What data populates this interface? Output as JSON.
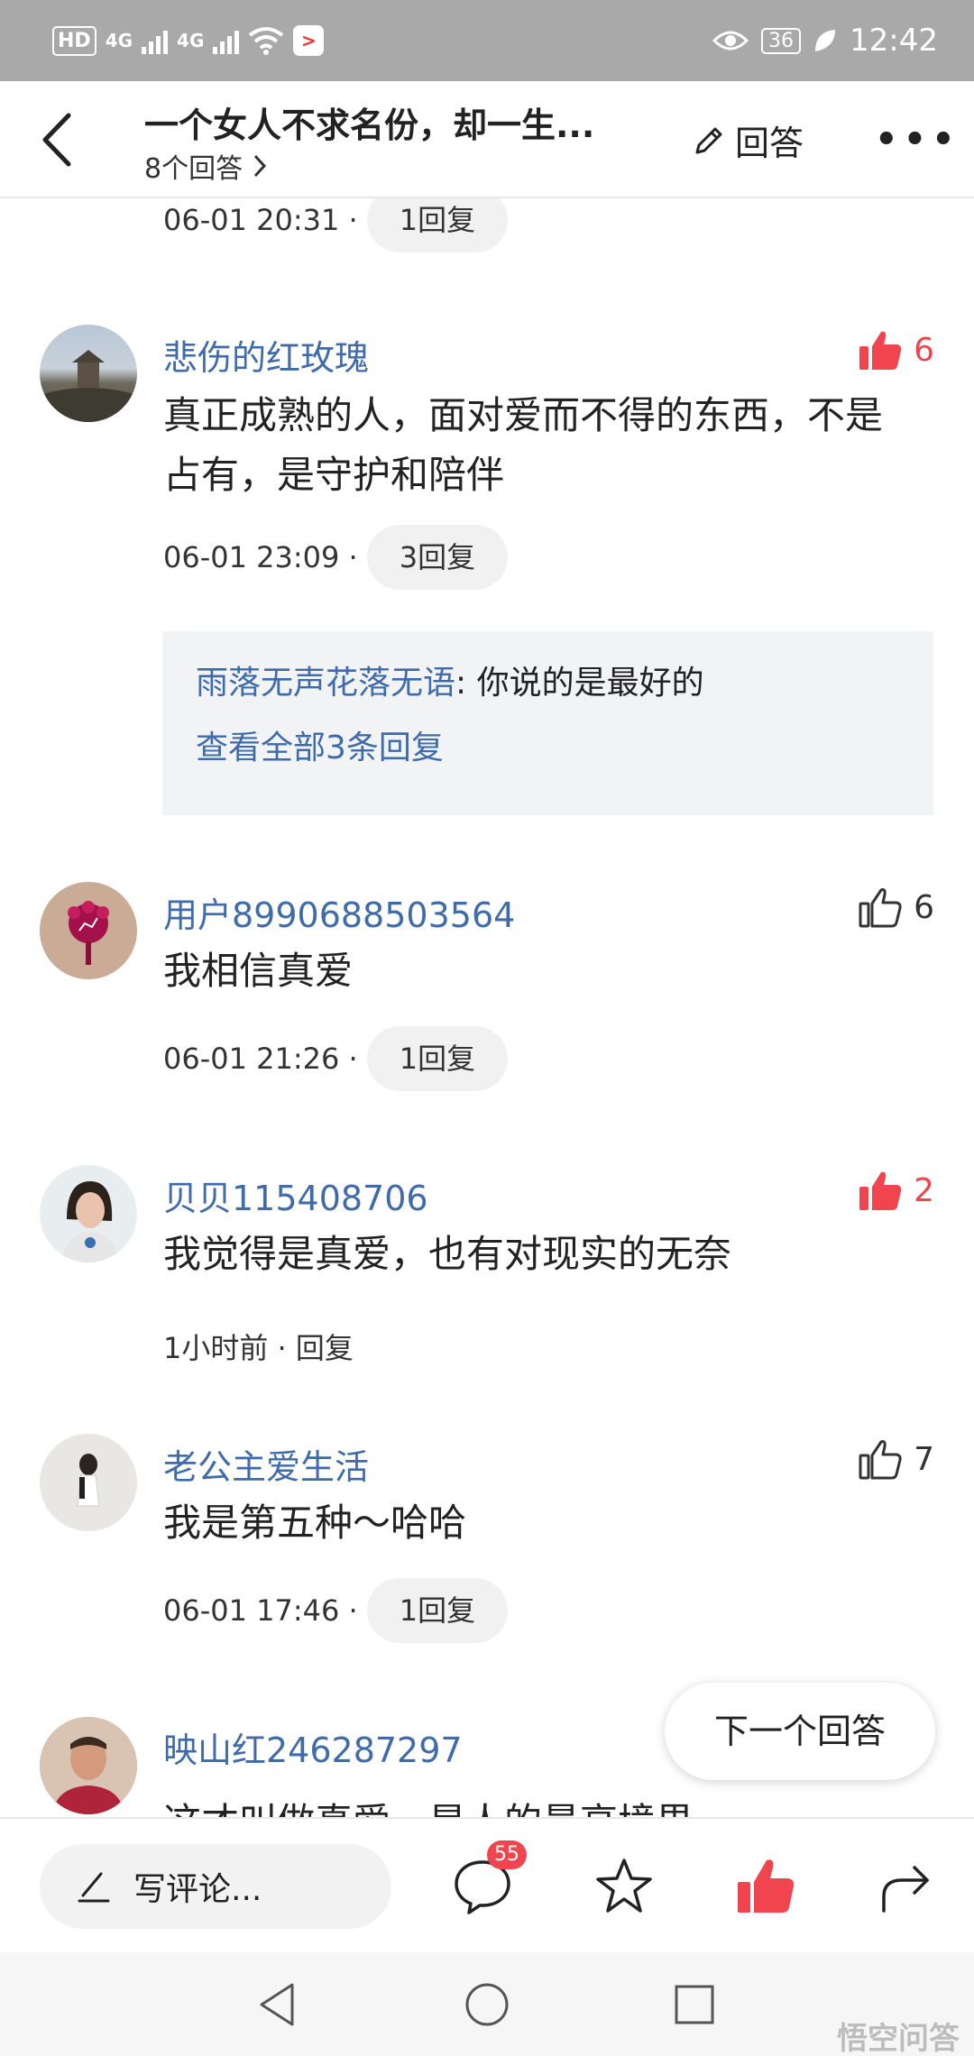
{
  "status_bar": {
    "hd": "HD",
    "net1": "4G",
    "net2": "4G",
    "app_badge": ">",
    "battery": "36",
    "time": "12:42"
  },
  "header": {
    "title": "一个女人不求名份，却一生...",
    "subtitle": "8个回答",
    "answer_label": "回答",
    "more": "•••"
  },
  "prev_comment_meta": {
    "time": "06-01 20:31 ·",
    "reply": "1回复"
  },
  "comments": [
    {
      "name": "悲伤的红玫瑰",
      "likes": "6",
      "liked": true,
      "text": "真正成熟的人，面对爱而不得的东西，不是占有，是守护和陪伴",
      "time": "06-01 23:09 ·",
      "reply": "3回复",
      "sub_reply": {
        "user": "雨落无声花落无语",
        "text": ": 你说的是最好的",
        "more": "查看全部3条回复"
      }
    },
    {
      "name": "用户8990688503564",
      "likes": "6",
      "liked": false,
      "text": "我相信真爱",
      "time": "06-01 21:26 ·",
      "reply": "1回复"
    },
    {
      "name": "贝贝115408706",
      "likes": "2",
      "liked": true,
      "text": "我觉得是真爱，也有对现实的无奈",
      "time": "1小时前 · 回复"
    },
    {
      "name": "老公主爱生活",
      "likes": "7",
      "liked": false,
      "text": "我是第五种～哈哈",
      "time": "06-01 17:46 ·",
      "reply": "1回复"
    },
    {
      "name": "映山红246287297",
      "text": "这才叫做真爱，是人的最高境界"
    }
  ],
  "next_answer": "下一个回答",
  "bottom_bar": {
    "write_placeholder": "写评论...",
    "comment_count": "55"
  },
  "watermark": "悟空问答",
  "colors": {
    "link_blue": "#3f6bab",
    "like_red": "#f0454f",
    "status_bar_gray": "#a9a9a9"
  }
}
